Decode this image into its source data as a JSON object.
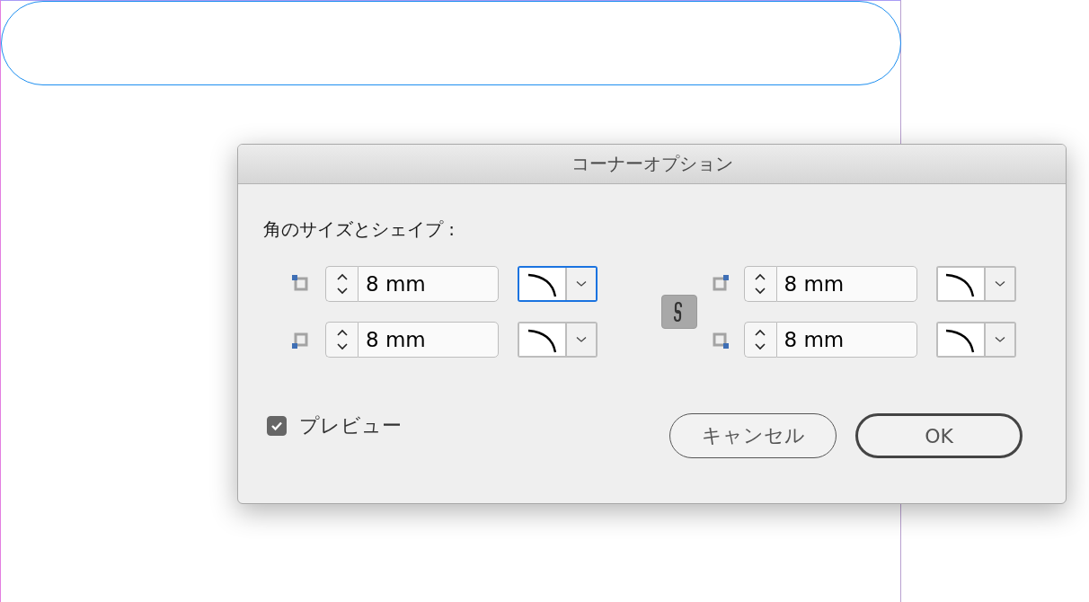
{
  "dialog": {
    "title": "コーナーオプション",
    "section_label": "角のサイズとシェイプ :",
    "corners": [
      {
        "kind": "top-left",
        "value": "8 mm",
        "focused": true
      },
      {
        "kind": "top-right",
        "value": "8 mm",
        "focused": false
      },
      {
        "kind": "bottom-left",
        "value": "8 mm",
        "focused": false
      },
      {
        "kind": "bottom-right",
        "value": "8 mm",
        "focused": false
      }
    ],
    "link": {
      "on": true
    },
    "preview": {
      "label": "プレビュー",
      "checked": true
    },
    "buttons": [
      {
        "label": "キャンセル",
        "default": false
      },
      {
        "label": "OK",
        "default": true
      }
    ]
  }
}
